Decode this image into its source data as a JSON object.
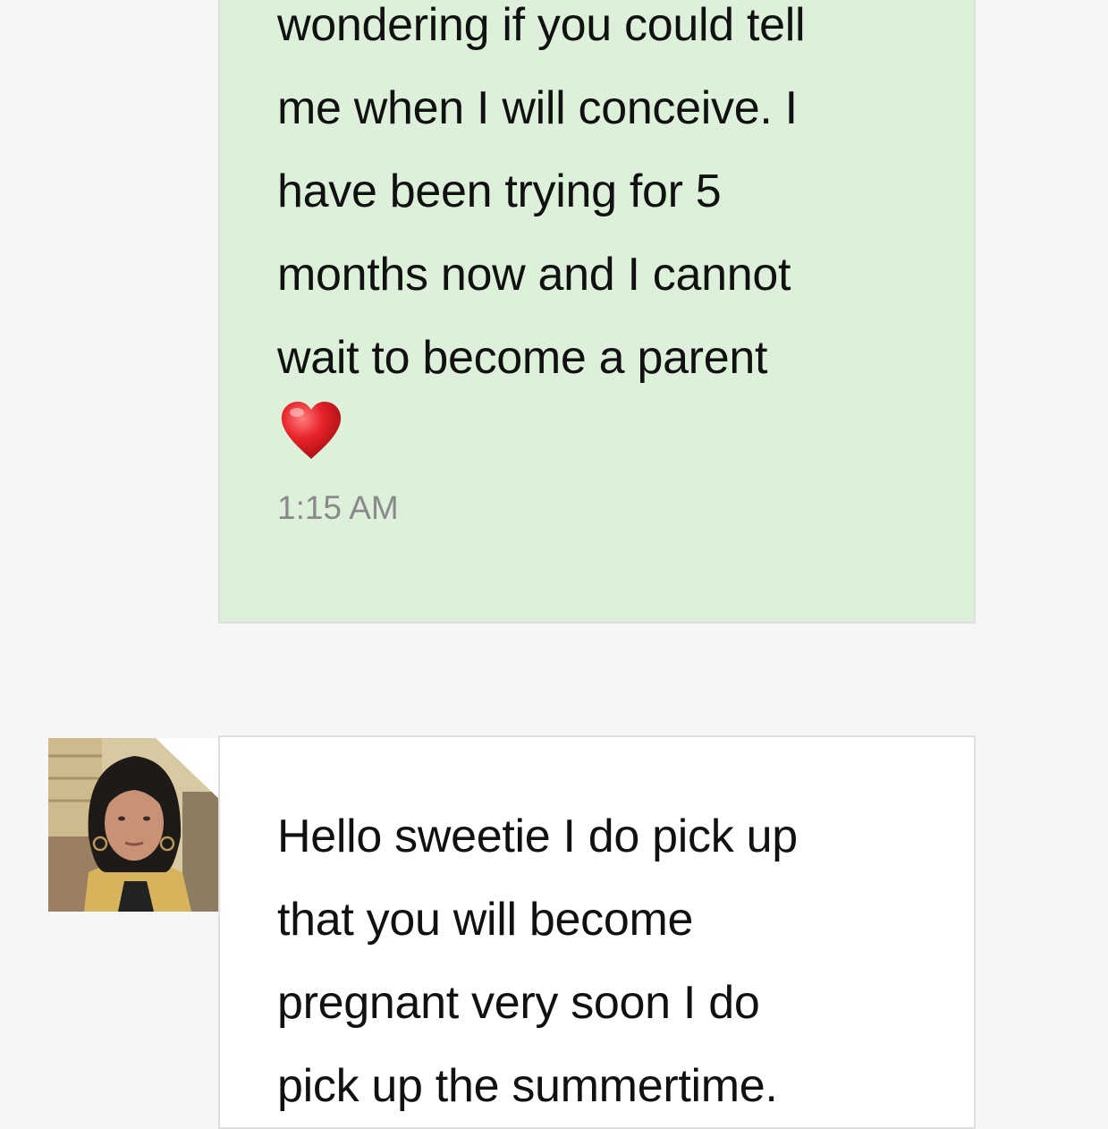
{
  "conversation": {
    "outgoing": {
      "text": "wondering if you could tell\nme when I will conceive. I\nhave been trying for 5\nmonths now and I cannot\nwait to become a parent",
      "emoji": "heart-icon",
      "time": "1:15 AM",
      "bubble_color": "#dcf0da"
    },
    "incoming": {
      "avatar": "advisor-photo",
      "text": "Hello sweetie I do pick up\nthat you will become\npregnant very soon I do\npick up the summertime.",
      "bubble_color": "#ffffff"
    }
  }
}
